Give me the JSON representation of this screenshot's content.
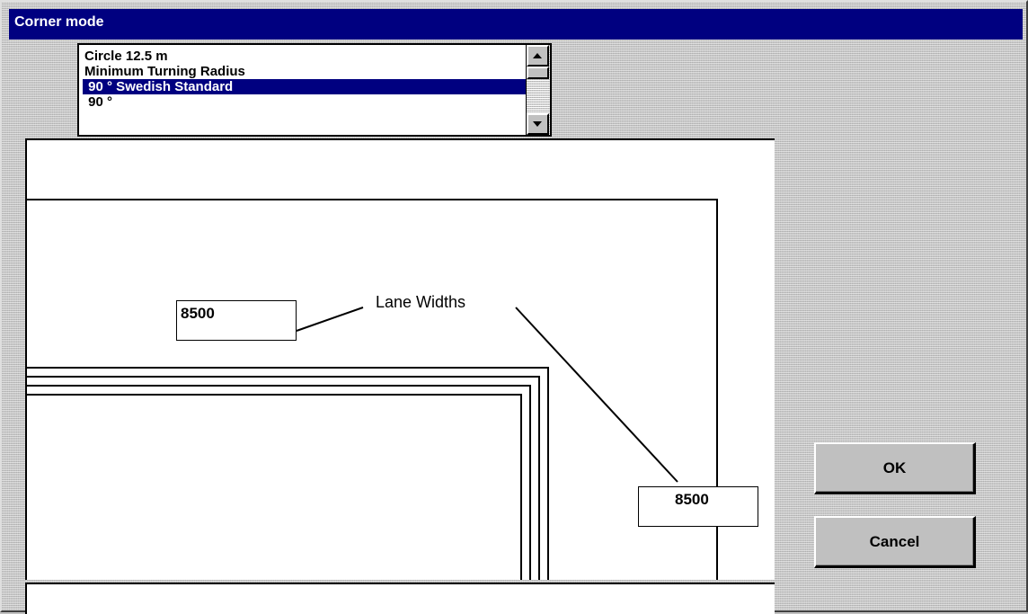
{
  "window": {
    "title": "Corner mode"
  },
  "list": {
    "items": [
      {
        "label": "Circle 12.5 m",
        "selected": false
      },
      {
        "label": "Minimum Turning Radius",
        "selected": false
      },
      {
        "label": " 90 ° Swedish Standard",
        "selected": true
      },
      {
        "label": " 90 °",
        "selected": false
      }
    ]
  },
  "preview": {
    "annotation": "Lane Widths",
    "width_left": "8500",
    "width_right": "8500"
  },
  "buttons": {
    "ok": "OK",
    "cancel": "Cancel"
  },
  "icons": {
    "scroll_up": "arrow-up-icon",
    "scroll_down": "arrow-down-icon"
  }
}
